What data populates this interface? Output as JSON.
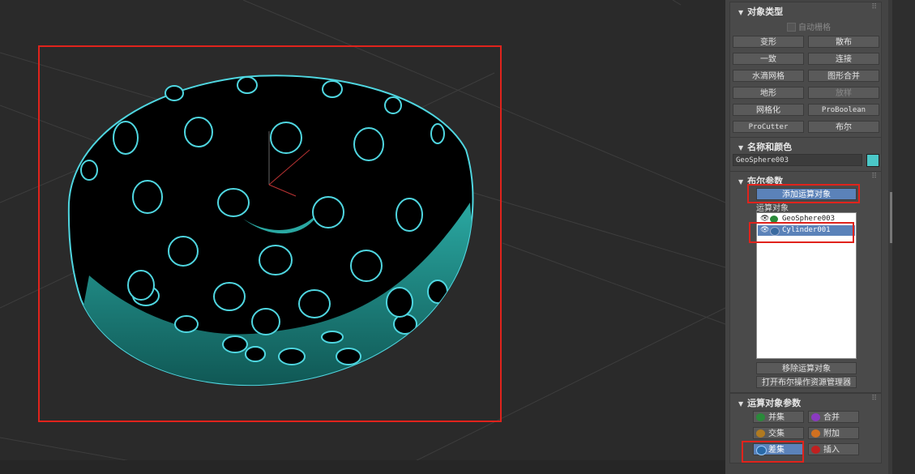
{
  "colors": {
    "accent_cyan": "#4fd6e0",
    "selection_blue": "#5b82b9",
    "annotation_red": "#e0231c",
    "object_color": "#4bc8c8"
  },
  "rollouts": {
    "object_type": {
      "title": "对象类型",
      "auto_grid": "自动栅格",
      "buttons": [
        "变形",
        "散布",
        "一致",
        "连接",
        "水滴网格",
        "图形合并",
        "地形",
        "放样",
        "网格化",
        "ProBoolean",
        "ProCutter",
        "布尔"
      ]
    },
    "name_color": {
      "title": "名称和颜色",
      "name_value": "GeoSphere003"
    },
    "boolean_params": {
      "title": "布尔参数",
      "add_operand_button": "添加运算对象",
      "operands_label": "运算对象",
      "operands": [
        "GeoSphere003",
        "Cylinder001"
      ],
      "remove_operand_button": "移除运算对象",
      "open_explorer_button": "打开布尔操作资源管理器"
    },
    "operand_params": {
      "title": "运算对象参数",
      "ops": [
        "并集",
        "合并",
        "交集",
        "附加",
        "差集",
        "插入"
      ]
    }
  }
}
